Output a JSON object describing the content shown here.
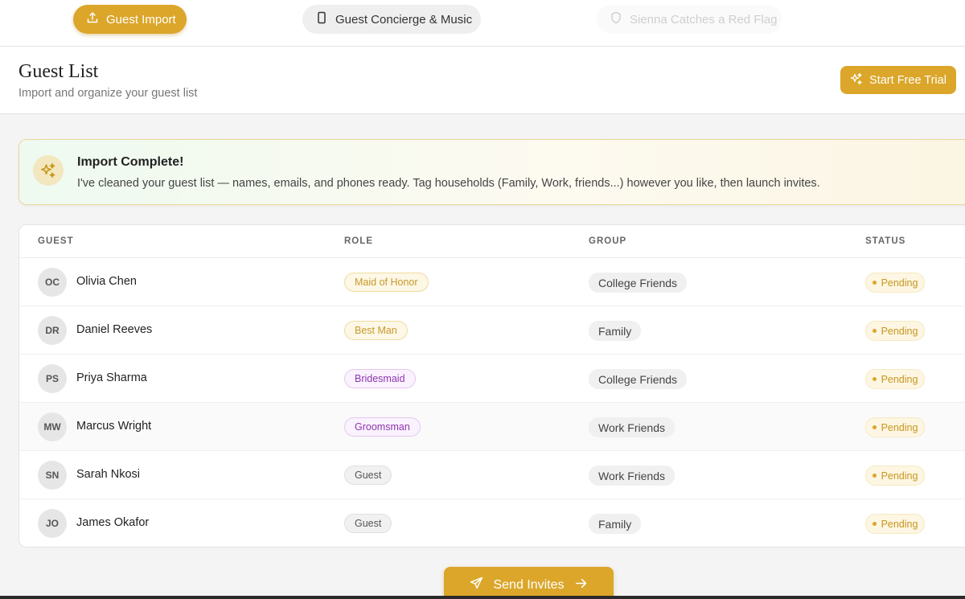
{
  "tabs": [
    {
      "label": "Guest Import",
      "icon": "upload-icon",
      "state": "active"
    },
    {
      "label": "Guest Concierge & Music",
      "icon": "phone-icon",
      "state": "inactive"
    },
    {
      "label": "Sienna Catches a Red Flag",
      "icon": "shield-icon",
      "state": "disabled"
    }
  ],
  "header": {
    "title": "Guest List",
    "subtitle": "Import and organize your guest list",
    "trial_label": "Start Free Trial",
    "trial_icon": "sparkles-icon"
  },
  "banner": {
    "icon": "sparkles-icon",
    "title": "Import Complete!",
    "text": "I've cleaned your guest list — names, emails, and phones ready. Tag households (Family, Work, friends...) however you like, then launch invites."
  },
  "table": {
    "headers": [
      "GUEST",
      "ROLE",
      "GROUP",
      "STATUS"
    ],
    "rows": [
      {
        "initials": "OC",
        "name": "Olivia Chen",
        "role": "Maid of Honor",
        "role_color": "gold",
        "group": "College Friends",
        "status": "Pending"
      },
      {
        "initials": "DR",
        "name": "Daniel Reeves",
        "role": "Best Man",
        "role_color": "gold",
        "group": "Family",
        "status": "Pending"
      },
      {
        "initials": "PS",
        "name": "Priya Sharma",
        "role": "Bridesmaid",
        "role_color": "purple",
        "group": "College Friends",
        "status": "Pending"
      },
      {
        "initials": "MW",
        "name": "Marcus Wright",
        "role": "Groomsman",
        "role_color": "purple",
        "group": "Work Friends",
        "status": "Pending"
      },
      {
        "initials": "SN",
        "name": "Sarah Nkosi",
        "role": "Guest",
        "role_color": "gray",
        "group": "Work Friends",
        "status": "Pending"
      },
      {
        "initials": "JO",
        "name": "James Okafor",
        "role": "Guest",
        "role_color": "gray",
        "group": "Family",
        "status": "Pending"
      }
    ]
  },
  "send": {
    "label": "Send Invites",
    "icon": "send-icon",
    "arrow_icon": "arrow-right-icon"
  },
  "colors": {
    "accent": "#dba629",
    "status_pending": "#c7961f",
    "role_purple": "#8e35b0"
  }
}
